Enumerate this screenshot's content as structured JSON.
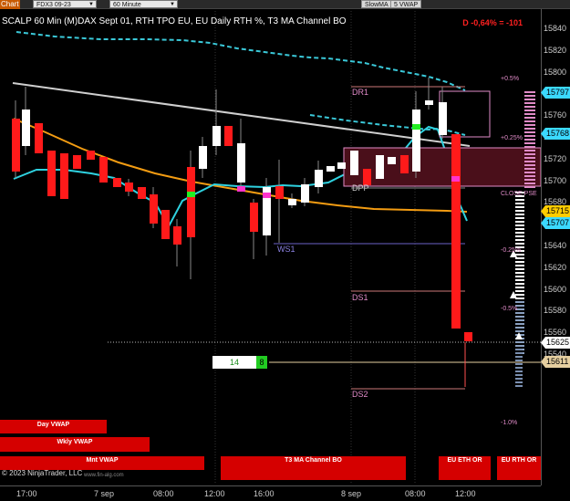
{
  "toolbar": {
    "chart_label": "Chart",
    "instrument": "FDX3 09-23",
    "interval": "60 Minute",
    "btn_slowma": "SlowMA",
    "btn_vwap": "5 VWAP"
  },
  "header": {
    "title": "SCALP 60 Min (M)DAX Sept 01, RTH TPO EU, EU Daily RTH %, T3 MA Channel BO",
    "change": "D -0,64% = -101"
  },
  "y_axis": {
    "ticks": [
      "15840",
      "15820",
      "15800",
      "15780",
      "15760",
      "15740",
      "15720",
      "15700",
      "15680",
      "15660",
      "15640",
      "15620",
      "15600",
      "15580",
      "15560",
      "15540"
    ],
    "price_tags": [
      {
        "label": "15797",
        "color": "#3bd9ff"
      },
      {
        "label": "15768",
        "color": "#3bd9ff"
      },
      {
        "label": "15715",
        "color": "#ffcc00"
      },
      {
        "label": "15707",
        "color": "#3bd9ff"
      },
      {
        "label": "15625",
        "color": "#ffffff"
      },
      {
        "label": "15611",
        "color": "#e6cfa0"
      }
    ]
  },
  "x_axis": {
    "ticks": [
      "17:00",
      "7 sep",
      "08:00",
      "12:00",
      "16:00",
      "8 sep",
      "08:00",
      "12:00"
    ]
  },
  "levels": {
    "dr1": "DR1",
    "dpp": "DPP",
    "ws1": "WS1",
    "ds1": "DS1",
    "ds2": "DS2",
    "p05": "+0.5%",
    "p025": "+0.25%",
    "close": "CLOSE PSE",
    "m025": "-0.25%",
    "m05": "-0.5%",
    "m10": "-1.0%"
  },
  "counter": {
    "value": "14",
    "badge": "8"
  },
  "buttons": {
    "day_vwap": "Day VWAP",
    "wkly_vwap": "Wkly VWAP",
    "mnt_vwap": "Mnt VWAP",
    "t3": "T3 MA Channel BO",
    "eu_eth": "EU ETH OR",
    "eu_rth": "EU RTH OR"
  },
  "footer": {
    "copyright": "© 2023 NinjaTrader, LLC",
    "website": "www.fin-alg.com"
  },
  "colors": {
    "up_candle": "#ffffff",
    "down_candle": "#ff1a1a",
    "ma_cyan": "#2fd2e0",
    "ma_orange": "#f39c12",
    "vwap_white": "#cccccc",
    "band_cyan": "#3ac8d8",
    "channel_pink": "#e08bc8"
  }
}
